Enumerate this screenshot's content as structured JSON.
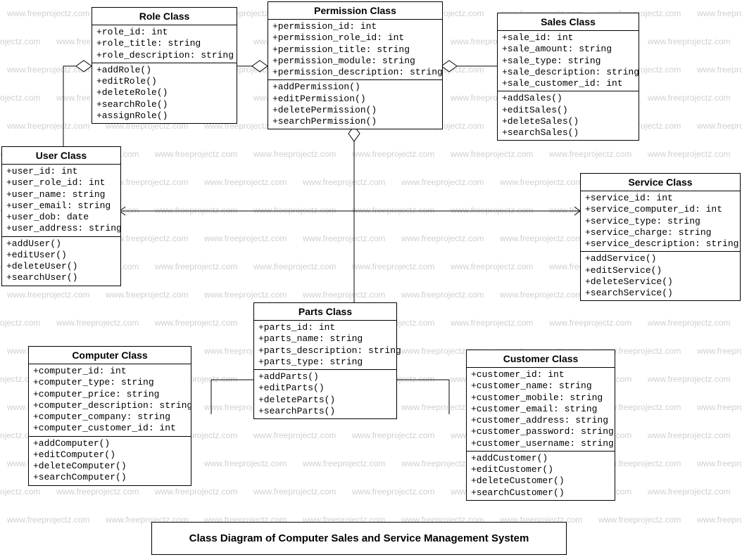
{
  "watermark_text": "www.freeprojectz.com",
  "caption": "Class Diagram of Computer Sales and Service Management System",
  "classes": {
    "role": {
      "title": "Role Class",
      "attrs": [
        "+role_id: int",
        "+role_title: string",
        "+role_description: string"
      ],
      "methods": [
        "+addRole()",
        "+editRole()",
        "+deleteRole()",
        "+searchRole()",
        "+assignRole()"
      ]
    },
    "permission": {
      "title": "Permission Class",
      "attrs": [
        "+permission_id: int",
        "+permission_role_id: int",
        "+permission_title: string",
        "+permission_module: string",
        "+permission_description: string"
      ],
      "methods": [
        "+addPermission()",
        "+editPermission()",
        "+deletePermission()",
        "+searchPermission()"
      ]
    },
    "sales": {
      "title": "Sales Class",
      "attrs": [
        "+sale_id: int",
        "+sale_amount: string",
        "+sale_type: string",
        "+sale_description: string",
        "+sale_customer_id: int"
      ],
      "methods": [
        "+addSales()",
        "+editSales()",
        "+deleteSales()",
        "+searchSales()"
      ]
    },
    "user": {
      "title": "User Class",
      "attrs": [
        "+user_id: int",
        "+user_role_id: int",
        "+user_name: string",
        "+user_email: string",
        "+user_dob: date",
        "+user_address: string"
      ],
      "methods": [
        "+addUser()",
        "+editUser()",
        "+deleteUser()",
        "+searchUser()"
      ]
    },
    "service": {
      "title": "Service Class",
      "attrs": [
        "+service_id: int",
        "+service_computer_id: int",
        "+service_type: string",
        "+service_charge: string",
        "+service_description: string"
      ],
      "methods": [
        "+addService()",
        "+editService()",
        "+deleteService()",
        "+searchService()"
      ]
    },
    "parts": {
      "title": "Parts Class",
      "attrs": [
        "+parts_id: int",
        "+parts_name: string",
        "+parts_description: string",
        "+parts_type: string"
      ],
      "methods": [
        "+addParts()",
        "+editParts()",
        "+deleteParts()",
        "+searchParts()"
      ]
    },
    "computer": {
      "title": "Computer Class",
      "attrs": [
        "+computer_id: int",
        "+computer_type: string",
        "+computer_price: string",
        "+computer_description: string",
        "+computer_company: string",
        "+computer_customer_id: int"
      ],
      "methods": [
        "+addComputer()",
        "+editComputer()",
        "+deleteComputer()",
        "+searchComputer()"
      ]
    },
    "customer": {
      "title": "Customer Class",
      "attrs": [
        "+customer_id: int",
        "+customer_name: string",
        "+customer_mobile: string",
        "+customer_email: string",
        "+customer_address: string",
        "+customer_password: string",
        "+customer_username: string"
      ],
      "methods": [
        "+addCustomer()",
        "+editCustomer()",
        "+deleteCustomer()",
        "+searchCustomer()"
      ]
    }
  }
}
